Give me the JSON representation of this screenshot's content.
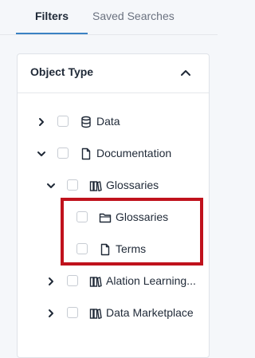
{
  "tabs": {
    "filters_label": "Filters",
    "saved_searches_label": "Saved Searches"
  },
  "panel": {
    "title": "Object Type"
  },
  "tree": {
    "data": "Data",
    "documentation": "Documentation",
    "glossaries_parent": "Glossaries",
    "glossaries_child": "Glossaries",
    "terms": "Terms",
    "alation_learning": "Alation Learning...",
    "data_marketplace": "Data Marketplace"
  },
  "colors": {
    "accent": "#3b82c4",
    "highlight": "#c0121c"
  }
}
